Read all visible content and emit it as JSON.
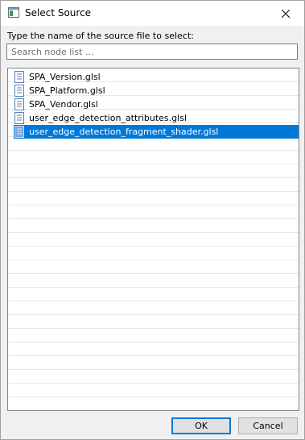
{
  "window": {
    "title": "Select Source",
    "icon": "window-app-icon",
    "close_icon": "close-icon"
  },
  "prompt": "Type the name of the source file to select:",
  "search": {
    "placeholder": "Search node list ...",
    "value": ""
  },
  "list": {
    "items": [
      {
        "label": "SPA_Version.glsl",
        "icon": "file-icon",
        "selected": false
      },
      {
        "label": "SPA_Platform.glsl",
        "icon": "file-icon",
        "selected": false
      },
      {
        "label": "SPA_Vendor.glsl",
        "icon": "file-icon",
        "selected": false
      },
      {
        "label": "user_edge_detection_attributes.glsl",
        "icon": "file-icon",
        "selected": false
      },
      {
        "label": "user_edge_detection_fragment_shader.glsl",
        "icon": "file-icon",
        "selected": true
      }
    ]
  },
  "buttons": {
    "ok": "OK",
    "cancel": "Cancel"
  },
  "colors": {
    "selection": "#0078d7",
    "background": "#f0f0f0"
  }
}
